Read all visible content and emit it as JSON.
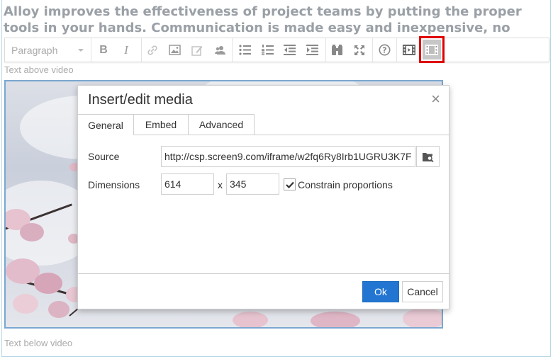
{
  "background_text": "Alloy improves the effectiveness of project teams by putting the proper tools in your hands. Communication is made easy and inexpensive, no",
  "toolbar": {
    "format_select": "Paragraph",
    "buttons": [
      "bold-icon",
      "italic-icon",
      "link-icon",
      "image-icon",
      "edit-image-icon",
      "user-icon",
      "bullet-list-icon",
      "numbered-list-icon",
      "outdent-icon",
      "indent-icon",
      "find-icon",
      "fullscreen-icon",
      "help-icon",
      "media-icon",
      "media-active-icon"
    ],
    "bold": "B",
    "italic": "I"
  },
  "content": {
    "text_above": "Text above video",
    "text_below": "Text below video"
  },
  "dialog": {
    "title": "Insert/edit media",
    "close": "×",
    "tabs": [
      {
        "label": "General",
        "active": true
      },
      {
        "label": "Embed",
        "active": false
      },
      {
        "label": "Advanced",
        "active": false
      }
    ],
    "source_label": "Source",
    "source_value": "http://csp.screen9.com/iframe/w2fq6Ry8Irb1UGRU3K7F",
    "dimensions_label": "Dimensions",
    "width_value": "614",
    "x_separator": "x",
    "height_value": "345",
    "constrain_label": "Constrain proportions",
    "constrain_checked": true,
    "ok_label": "Ok",
    "cancel_label": "Cancel"
  },
  "colors": {
    "ok_button": "#2276d2",
    "highlight_border": "#e00000",
    "video_border": "#7aa7cf"
  }
}
